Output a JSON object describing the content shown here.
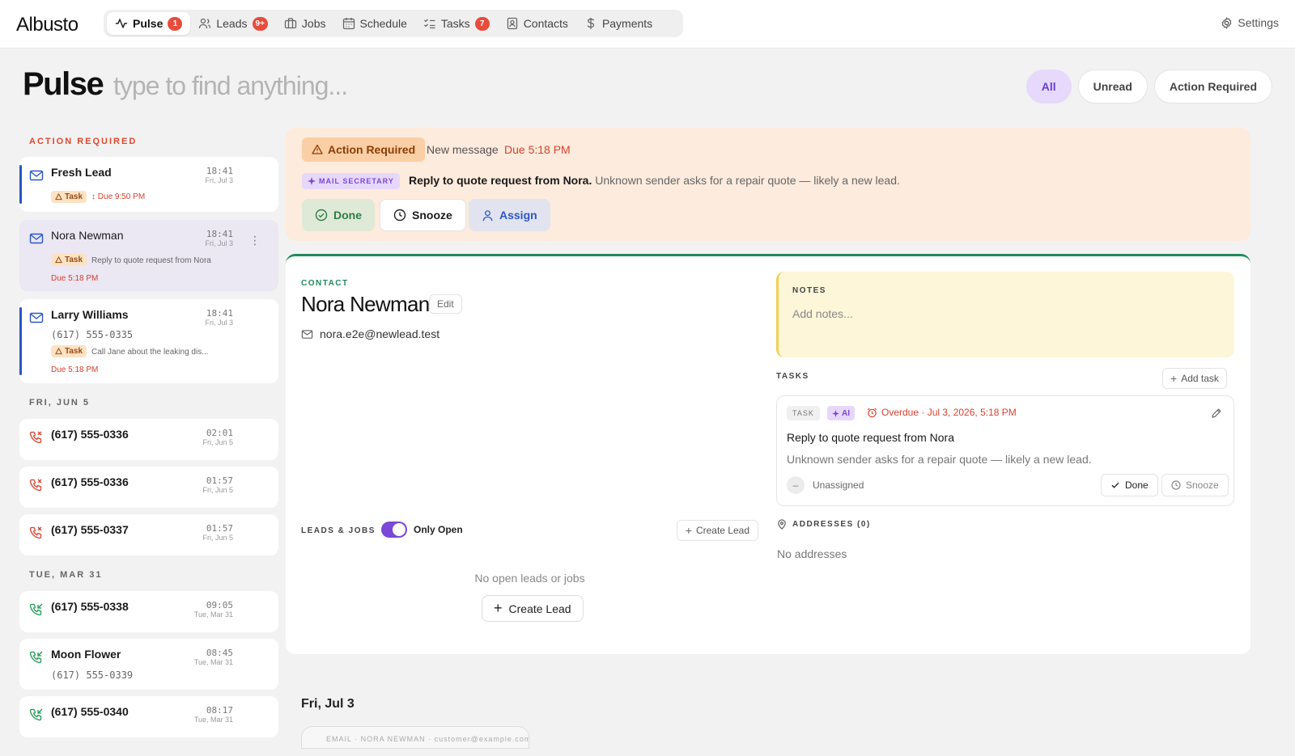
{
  "app": {
    "name": "Albusto"
  },
  "nav": {
    "items": [
      {
        "label": "Pulse",
        "badge": "1",
        "icon": "activity-icon",
        "active": true
      },
      {
        "label": "Leads",
        "badge": "9+",
        "icon": "users-icon"
      },
      {
        "label": "Jobs",
        "badge": "",
        "icon": "briefcase-icon"
      },
      {
        "label": "Schedule",
        "badge": "",
        "icon": "calendar-icon"
      },
      {
        "label": "Tasks",
        "badge": "7",
        "icon": "checklist-icon"
      },
      {
        "label": "Contacts",
        "badge": "",
        "icon": "contact-book-icon"
      },
      {
        "label": "Payments",
        "badge": "",
        "icon": "dollar-icon"
      }
    ],
    "settings_label": "Settings"
  },
  "header": {
    "title": "Pulse",
    "search_placeholder": "type to find anything...",
    "filters": [
      "All",
      "Unread",
      "Action Required"
    ],
    "active_filter": "All"
  },
  "sidebar": {
    "sections": [
      {
        "label": "ACTION REQUIRED"
      },
      {
        "label": "FRI, JUN 5"
      },
      {
        "label": "TUE, MAR 31"
      }
    ],
    "action_items": [
      {
        "name": "Fresh Lead",
        "time": "18:41",
        "date": "Fri, Jul 3",
        "task_label": "Task",
        "task_text": "Due 9:50 PM",
        "due": ""
      },
      {
        "name": "Nora Newman",
        "time": "18:41",
        "date": "Fri, Jul 3",
        "task_label": "Task",
        "task_text": "Reply to quote request from Nora",
        "due": "Due 5:18 PM"
      },
      {
        "name": "Larry Williams",
        "time": "18:41",
        "date": "Fri, Jul 3",
        "phone": "(617) 555-0335",
        "task_label": "Task",
        "task_text": "Call Jane about the leaking dis...",
        "due": "Due 5:18 PM"
      }
    ],
    "jun5_items": [
      {
        "name": "(617) 555-0336",
        "time": "02:01",
        "date": "Fri, Jun 5"
      },
      {
        "name": "(617) 555-0336",
        "time": "01:57",
        "date": "Fri, Jun 5"
      },
      {
        "name": "(617) 555-0337",
        "time": "01:57",
        "date": "Fri, Jun 5"
      }
    ],
    "mar31_items": [
      {
        "name": "(617) 555-0338",
        "time": "09:05",
        "date": "Tue, Mar 31"
      },
      {
        "name": "Moon Flower",
        "time": "08:45",
        "date": "Tue, Mar 31",
        "phone": "(617) 555-0339"
      },
      {
        "name": "(617) 555-0340",
        "time": "08:17",
        "date": "Tue, Mar 31"
      }
    ]
  },
  "action": {
    "tag": "Action Required",
    "message": "New message",
    "due": "Due 5:18 PM",
    "source": "MAIL SECRETARY",
    "title": "Reply to quote request from Nora.",
    "description": "Unknown sender asks for a repair quote — likely a new lead.",
    "buttons": {
      "done": "Done",
      "snooze": "Snooze",
      "assign": "Assign"
    }
  },
  "contact": {
    "label": "CONTACT",
    "name": "Nora Newman",
    "edit_label": "Edit",
    "email": "nora.e2e@newlead.test"
  },
  "leads": {
    "label": "LEADS & JOBS",
    "toggle_label": "Only Open",
    "toggle_on": true,
    "create_small": "Create Lead",
    "empty": "No open leads or jobs",
    "create_large": "Create Lead"
  },
  "notes": {
    "label": "NOTES",
    "placeholder": "Add notes..."
  },
  "tasks": {
    "label": "TASKS",
    "add_label": "Add task",
    "task": {
      "tag": "TASK",
      "ai_tag": "AI",
      "overdue": "Overdue · Jul 3, 2026, 5:18 PM",
      "title": "Reply to quote request from Nora",
      "description": "Unknown sender asks for a repair quote — likely a new lead.",
      "assignee": "Unassigned",
      "done_label": "Done",
      "snooze_label": "Snooze"
    }
  },
  "addresses": {
    "label": "ADDRESSES (0)",
    "empty": "No addresses"
  },
  "timeline": {
    "day": "Fri, Jul 3",
    "chip": "EMAIL · NORA NEWMAN · customer@example.com"
  },
  "colors": {
    "accent_purple": "#7b47d6",
    "alert_red": "#e74c3c",
    "contact_green": "#1f8a5b",
    "action_bg": "#fdebdd"
  }
}
